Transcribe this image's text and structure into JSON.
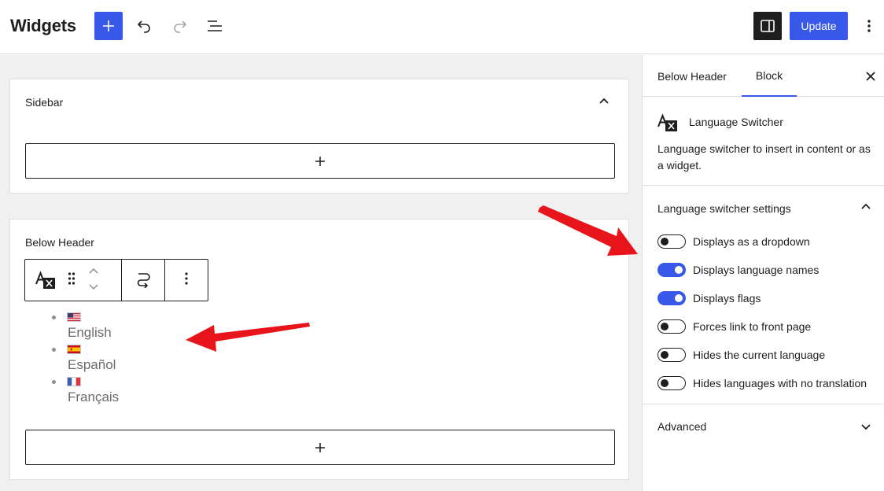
{
  "header": {
    "title": "Widgets",
    "update_label": "Update"
  },
  "canvas": {
    "sidebar_area": {
      "title": "Sidebar"
    },
    "below_header_area": {
      "title": "Below Header"
    },
    "languages": [
      {
        "name": "English",
        "flag": "us-flag"
      },
      {
        "name": "Español",
        "flag": "spain-flag"
      },
      {
        "name": "Français",
        "flag": "france-flag"
      }
    ]
  },
  "sidebar": {
    "tabs": [
      {
        "label": "Below Header",
        "active": false
      },
      {
        "label": "Block",
        "active": true
      }
    ],
    "block": {
      "name": "Language Switcher",
      "description": "Language switcher to insert in content or as a widget."
    },
    "settings_panel": {
      "title": "Language switcher settings",
      "toggles": [
        {
          "label": "Displays as a dropdown",
          "on": false
        },
        {
          "label": "Displays language names",
          "on": true
        },
        {
          "label": "Displays flags",
          "on": true
        },
        {
          "label": "Forces link to front page",
          "on": false
        },
        {
          "label": "Hides the current language",
          "on": false
        },
        {
          "label": "Hides languages with no translation",
          "on": false
        }
      ]
    },
    "advanced_panel": {
      "title": "Advanced"
    }
  },
  "colors": {
    "accent": "#3858e9",
    "annotation_arrow": "#e8141b"
  }
}
